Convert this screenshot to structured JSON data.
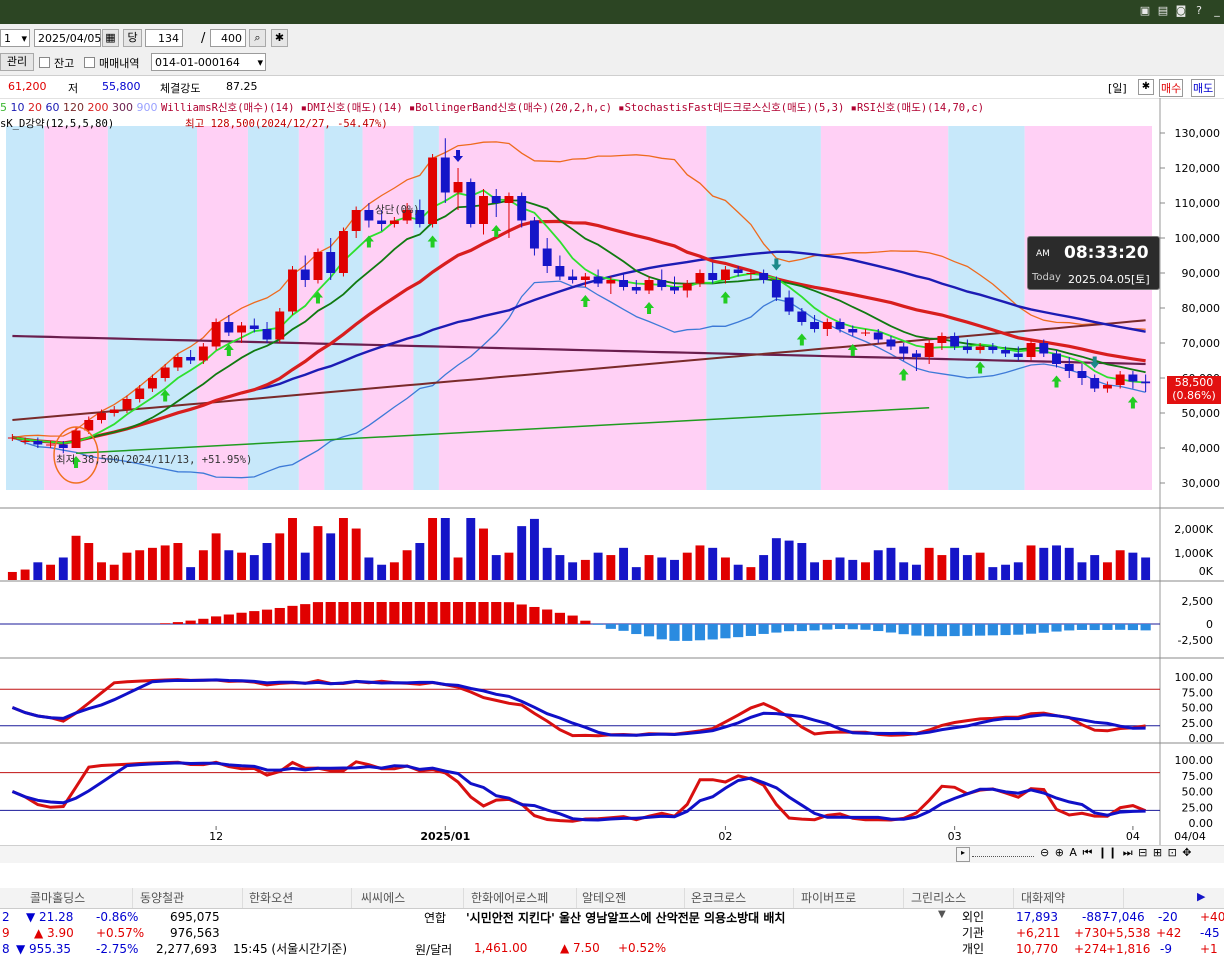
{
  "toolbar": {
    "period_value": "1",
    "date_value": "2025/04/05",
    "dang_label": "당",
    "count_value": "134",
    "slash": "/",
    "total_value": "400",
    "account_button": "관리",
    "jango_label": "잔고",
    "trade_history_label": "매매내역",
    "account_value": "014-01-000164"
  },
  "price_info": {
    "prev_price": "61,200",
    "low_label": "저",
    "low_value": "55,800",
    "strength_label": "체결강도",
    "strength_value": "87.25",
    "period_btn": "[일]",
    "buy_btn": "매수",
    "sell_btn": "매도"
  },
  "legend": {
    "ma_items": [
      "5",
      "10",
      "20",
      "60",
      "120",
      "200",
      "300",
      "900"
    ],
    "signals": "WilliamsR신호(매수)(14) ▪DMI신호(매도)(14) ▪BollingerBand신호(매수)(20,2,h,c) ▪StochastisFast데드크로스신호(매도)(5,3) ▪RSI신호(매도)(14,70,c)",
    "sub": "sK_D강약(12,5,5,80)",
    "high_note": "최고 128,500(2024/12/27, -54.47%)",
    "low_note": "최저 38,500(2024/11/13, +51.95%)",
    "mid_note": "상단(0%)"
  },
  "clock": {
    "ampm": "AM",
    "time": "08:33:20",
    "today_label": "Today",
    "today_value": "2025.04.05[토]"
  },
  "price_tag": {
    "price": "58,500",
    "pct": "(0.86%)"
  },
  "colors": {
    "up": "#e00000",
    "down": "#1515c8",
    "pink_band": "#ffd0f5",
    "blue_band": "#c7e8fa",
    "ma5": "#3cb731",
    "ma20": "#d81e1e",
    "ma60": "#1c1cb4",
    "ma120": "#7a2a2a",
    "ma200": "#6a1e4e",
    "bb": "#ee6a1e",
    "bbl": "#3d7ad7",
    "trend": "#1f9c1f"
  },
  "chart_data": [
    {
      "type": "candlestick",
      "title": "",
      "ylim": [
        28000,
        132000
      ],
      "yticks": [
        "130,000",
        "120,000",
        "110,000",
        "100,000",
        "90,000",
        "80,000",
        "70,000",
        "60,000",
        "50,000",
        "40,000",
        "30,000"
      ],
      "xticks": [
        "12",
        "2025/01",
        "02",
        "03",
        "04"
      ],
      "last_date": "04/04",
      "ohlc": [
        [
          43,
          44,
          42,
          43
        ],
        [
          42,
          43,
          41,
          42
        ],
        [
          42,
          43,
          40,
          41
        ],
        [
          41,
          42,
          40,
          41
        ],
        [
          41,
          42,
          38.5,
          40
        ],
        [
          40,
          46,
          40,
          45
        ],
        [
          45,
          49,
          44,
          48
        ],
        [
          48,
          51,
          47,
          50
        ],
        [
          50,
          52,
          49,
          51
        ],
        [
          51,
          55,
          50,
          54
        ],
        [
          54,
          58,
          53,
          57
        ],
        [
          57,
          61,
          56,
          60
        ],
        [
          60,
          64,
          59,
          63
        ],
        [
          63,
          67,
          62,
          66
        ],
        [
          66,
          68,
          64,
          65
        ],
        [
          65,
          70,
          64,
          69
        ],
        [
          69,
          77,
          68,
          76
        ],
        [
          76,
          78,
          72,
          73
        ],
        [
          73,
          76,
          70,
          75
        ],
        [
          75,
          77,
          73,
          74
        ],
        [
          74,
          76,
          70,
          71
        ],
        [
          71,
          80,
          70,
          79
        ],
        [
          79,
          92,
          78,
          91
        ],
        [
          91,
          95,
          86,
          88
        ],
        [
          88,
          97,
          87,
          96
        ],
        [
          96,
          100,
          88,
          90
        ],
        [
          90,
          103,
          89,
          102
        ],
        [
          102,
          109,
          100,
          108
        ],
        [
          108,
          110,
          103,
          105
        ],
        [
          105,
          108,
          102,
          104
        ],
        [
          104,
          106,
          103,
          105
        ],
        [
          105,
          110,
          104,
          108
        ],
        [
          108,
          111,
          103,
          104
        ],
        [
          104,
          124,
          103,
          123
        ],
        [
          123,
          128.5,
          110,
          113
        ],
        [
          113,
          120,
          108,
          116
        ],
        [
          116,
          117,
          103,
          104
        ],
        [
          104,
          114,
          101,
          112
        ],
        [
          112,
          114,
          106,
          110
        ],
        [
          110,
          113,
          100,
          112
        ],
        [
          112,
          113,
          103,
          105
        ],
        [
          105,
          106,
          95,
          97
        ],
        [
          97,
          100,
          90,
          92
        ],
        [
          92,
          95,
          88,
          89
        ],
        [
          89,
          91,
          87,
          88
        ],
        [
          88,
          90,
          86,
          89
        ],
        [
          89,
          91,
          86,
          87
        ],
        [
          87,
          89,
          84,
          88
        ],
        [
          88,
          90,
          85,
          86
        ],
        [
          86,
          88,
          84,
          85
        ],
        [
          85,
          89,
          84,
          88
        ],
        [
          88,
          91,
          85,
          86
        ],
        [
          86,
          89,
          84,
          85
        ],
        [
          85,
          88,
          83,
          87
        ],
        [
          87,
          91,
          86,
          90
        ],
        [
          90,
          93,
          87,
          88
        ],
        [
          88,
          92,
          87,
          91
        ],
        [
          91,
          92,
          89,
          90
        ],
        [
          90,
          91,
          88,
          90
        ],
        [
          90,
          91,
          87,
          88
        ],
        [
          88,
          89,
          82,
          83
        ],
        [
          83,
          85,
          78,
          79
        ],
        [
          79,
          80,
          75,
          76
        ],
        [
          76,
          78,
          73,
          74
        ],
        [
          74,
          77,
          72,
          76
        ],
        [
          76,
          77,
          73,
          74
        ],
        [
          74,
          75,
          72,
          73
        ],
        [
          73,
          74,
          72,
          73
        ],
        [
          73,
          74,
          70,
          71
        ],
        [
          71,
          72,
          68,
          69
        ],
        [
          69,
          70,
          65,
          67
        ],
        [
          67,
          68,
          62,
          66
        ],
        [
          66,
          71,
          64,
          70
        ],
        [
          70,
          73,
          68,
          72
        ],
        [
          72,
          73,
          68,
          69
        ],
        [
          69,
          71,
          67,
          68
        ],
        [
          68,
          70,
          67,
          69
        ],
        [
          69,
          70,
          67,
          68
        ],
        [
          68,
          69,
          66,
          67
        ],
        [
          67,
          69,
          65,
          66
        ],
        [
          66,
          71,
          65,
          70
        ],
        [
          70,
          71,
          66,
          67
        ],
        [
          67,
          68,
          63,
          64
        ],
        [
          64,
          66,
          60,
          62
        ],
        [
          62,
          64,
          58,
          60
        ],
        [
          60,
          61,
          56,
          57
        ],
        [
          57,
          59,
          55.8,
          58
        ],
        [
          58,
          62,
          57,
          61
        ],
        [
          61,
          62,
          57,
          59
        ],
        [
          59,
          61,
          56,
          58.5
        ]
      ]
    },
    {
      "type": "bar",
      "title": "",
      "yticks": [
        "2,000K",
        "1,000K",
        "0K"
      ],
      "ylim": [
        0,
        2500
      ]
    },
    {
      "type": "bar",
      "title": "",
      "yticks": [
        "2,500",
        "0",
        "-2,500"
      ],
      "ylim": [
        -3000,
        3000
      ]
    },
    {
      "type": "line",
      "title": "",
      "yticks": [
        "100.00",
        "75.00",
        "50.00",
        "25.00",
        "0.00"
      ],
      "ylim": [
        0,
        100
      ]
    },
    {
      "type": "line",
      "title": "",
      "yticks": [
        "100.00",
        "75.00",
        "50.00",
        "25.00",
        "0.00"
      ],
      "ylim": [
        0,
        100
      ]
    }
  ],
  "scroll": {
    "icons": "⊖ ⊕ A ⏮ ❙❙ ⏭ ⊟ ⊞ ⊡ ✥"
  },
  "ticker": {
    "tabs": [
      "콜마홀딩스",
      "동양철관",
      "한화오션",
      "씨씨에스",
      "한화에어로스페",
      "알테오젠",
      "온코크로스",
      "파이버프로",
      "그린리소스",
      "대화제약"
    ],
    "rows": [
      {
        "a": "2",
        "b": "▼ 21.28",
        "c": "-0.86%",
        "d": "695,075",
        "e": ""
      },
      {
        "a": "9",
        "b": "▲ 3.90",
        "c": "+0.57%",
        "d": "976,563",
        "e": ""
      },
      {
        "a": "8",
        "b": "▼ 955.35",
        "c": "-2.75%",
        "d": "2,277,693",
        "e": "15:45 (서울시간기준)"
      }
    ],
    "news_label": "연합",
    "news_text": "'시민안전 지킨다' 울산 영남알프스에 산악전문 의용소방대 배치",
    "fx_label": "원/달러",
    "fx_value": "1,461.00",
    "fx_change": "▲ 7.50",
    "fx_pct": "+0.52%",
    "investors": [
      {
        "name": "외인",
        "v1": "17,893",
        "v2": "-887",
        "v3": "-7,046",
        "v4": "-20",
        "v5": "+40"
      },
      {
        "name": "기관",
        "v1": "+6,211",
        "v2": "+730",
        "v3": "+5,538",
        "v4": "+42",
        "v5": "-45"
      },
      {
        "name": "개인",
        "v1": "10,770",
        "v2": "+274",
        "v3": "+1,816",
        "v4": "-9",
        "v5": "+1"
      }
    ]
  }
}
